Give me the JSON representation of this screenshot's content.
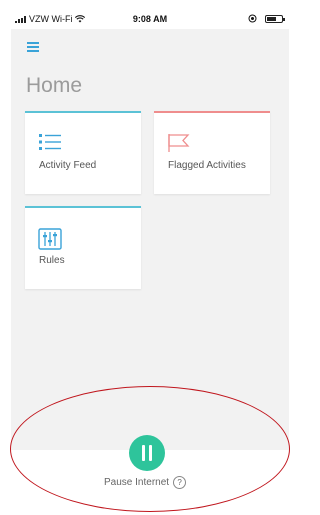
{
  "status_bar": {
    "carrier": "VZW Wi-Fi",
    "time": "9:08 AM"
  },
  "page": {
    "title": "Home"
  },
  "tiles": [
    {
      "label": "Activity Feed",
      "icon": "list-icon",
      "accent": "#5bc2d6"
    },
    {
      "label": "Flagged Activities",
      "icon": "flag-icon",
      "accent": "#ef8d8d"
    },
    {
      "label": "Rules",
      "icon": "sliders-icon",
      "accent": "#5bc2d6"
    }
  ],
  "pause": {
    "label": "Pause Internet",
    "help_glyph": "?",
    "color": "#2ec49b"
  },
  "colors": {
    "menu": "#3aa3d8",
    "annotation_circle": "#c0161d"
  }
}
